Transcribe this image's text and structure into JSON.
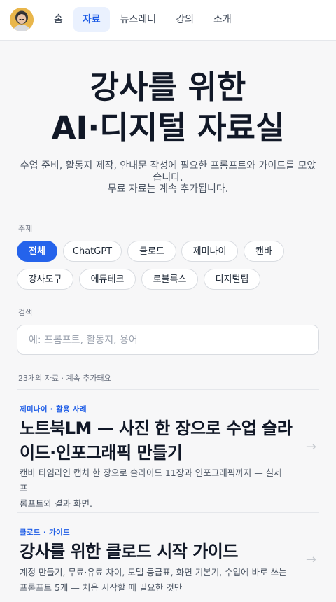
{
  "nav": {
    "items": [
      {
        "label": "홈"
      },
      {
        "label": "자료"
      },
      {
        "label": "뉴스레터"
      },
      {
        "label": "강의"
      },
      {
        "label": "소개"
      }
    ],
    "active_index": 1
  },
  "hero": {
    "title_line1": "강사를 위한",
    "title_line2": "AI·디지털 자료실",
    "subtitle_line1": "수업 준비, 활동지 제작, 안내문 작성에 필요한 프롬프트와 가이드를 모았",
    "subtitle_line2": "습니다.",
    "subtitle_line3": "무료 자료는 계속 추가됩니다."
  },
  "filters": {
    "label": "주제",
    "chips": [
      {
        "label": "전체"
      },
      {
        "label": "ChatGPT"
      },
      {
        "label": "클로드"
      },
      {
        "label": "제미나이"
      },
      {
        "label": "캔바"
      },
      {
        "label": "강사도구"
      },
      {
        "label": "에듀테크"
      },
      {
        "label": "로블록스"
      },
      {
        "label": "디지털팁"
      }
    ]
  },
  "search": {
    "label": "검색",
    "placeholder": "예: 프롬프트, 활동지, 용어",
    "value": ""
  },
  "results": {
    "count_text": "23개의 자료 · 계속 추가돼요"
  },
  "cards": [
    {
      "tag": "제미나이 · 활용 사례",
      "title_line1": "노트북LM — 사진 한 장으로 수업 슬라",
      "title_line2": "이드·인포그래픽 만들기",
      "desc_line1": "캔바 타임라인 캡처 한 장으로 슬라이드 11장과 인포그래픽까지 — 실제 프",
      "desc_line2": "롬프트와 결과 화면.",
      "arrow": "→"
    },
    {
      "tag": "클로드 · 가이드",
      "title_line1": "강사를 위한 클로드 시작 가이드",
      "desc_line1": "계정 만들기, 무료·유료 차이, 모델 등급표, 화면 기본기, 수업에 바로 쓰는",
      "desc_line2": "프롬프트 5개 — 처음 시작할 때 필요한 것만",
      "arrow": "→"
    }
  ],
  "colors": {
    "accent": "#2563eb",
    "nav_active_bg": "#eaf1fe",
    "background": "#f7f7f8"
  }
}
